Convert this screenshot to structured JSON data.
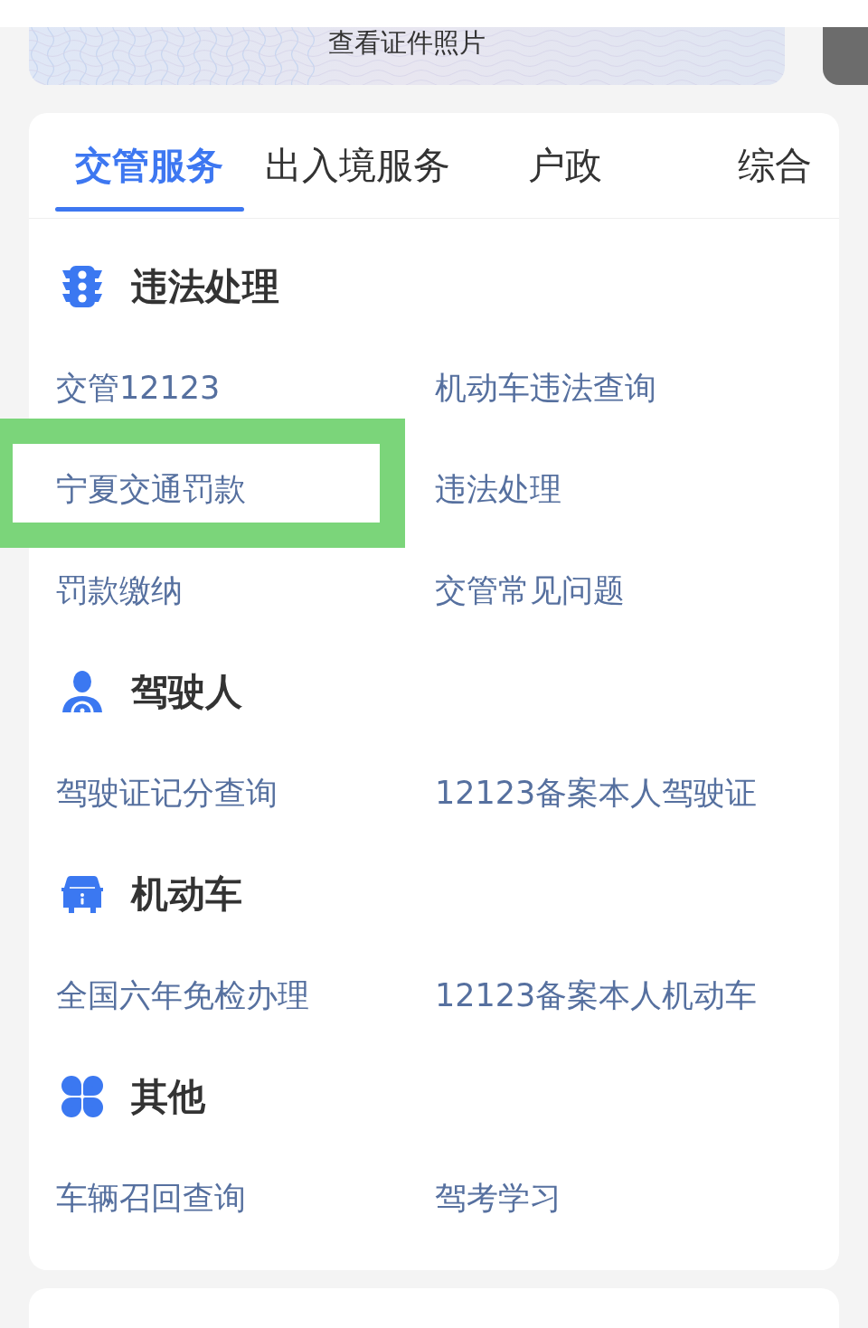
{
  "top_banner": {
    "label": "查看证件照片"
  },
  "tabs": [
    {
      "label": "交管服务",
      "selected": true
    },
    {
      "label": "出入境服务",
      "selected": false
    },
    {
      "label": "户政",
      "selected": false
    },
    {
      "label": "综合",
      "selected": false
    }
  ],
  "sections": [
    {
      "kind": "traffic_light",
      "title": "违法处理",
      "links": [
        {
          "label": "交管12123",
          "highlighted": false
        },
        {
          "label": "机动车违法查询",
          "highlighted": false
        },
        {
          "label": "宁夏交通罚款",
          "highlighted": true
        },
        {
          "label": "违法处理",
          "highlighted": false
        },
        {
          "label": "罚款缴纳",
          "highlighted": false
        },
        {
          "label": "交管常见问题",
          "highlighted": false
        }
      ]
    },
    {
      "kind": "driver",
      "title": "驾驶人",
      "links": [
        {
          "label": "驾驶证记分查询",
          "highlighted": false
        },
        {
          "label": "12123备案本人驾驶证",
          "highlighted": false
        }
      ]
    },
    {
      "kind": "car",
      "title": "机动车",
      "links": [
        {
          "label": "全国六年免检办理",
          "highlighted": false
        },
        {
          "label": "12123备案本人机动车",
          "highlighted": false
        }
      ]
    },
    {
      "kind": "grid",
      "title": "其他",
      "links": [
        {
          "label": "车辆召回查询",
          "highlighted": false
        },
        {
          "label": "驾考学习",
          "highlighted": false
        }
      ]
    }
  ]
}
